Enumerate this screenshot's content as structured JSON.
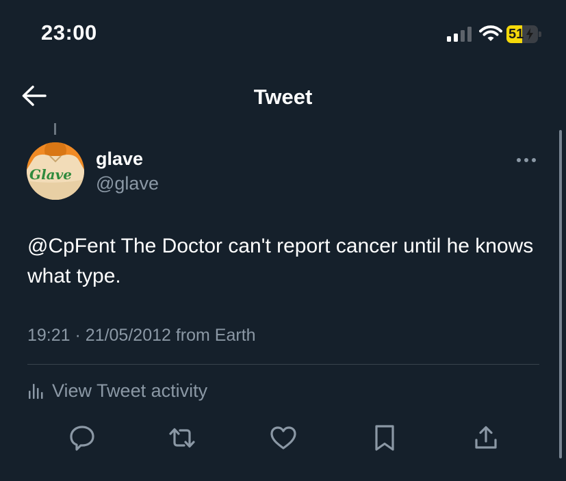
{
  "status_bar": {
    "time": "23:00",
    "battery_level": "51",
    "battery_color": "#f5d90a",
    "signal_bars_active": 2,
    "signal_bars_total": 4,
    "icons": [
      "signal-icon",
      "wifi-icon",
      "battery-icon",
      "charging-bolt-icon"
    ]
  },
  "nav": {
    "title": "Tweet",
    "back_icon": "back-arrow-icon"
  },
  "tweet": {
    "avatar": {
      "text": "Glave",
      "colors": [
        "#f08a24",
        "#2f8a3d",
        "#f2dcb8"
      ]
    },
    "display_name": "glave",
    "handle": "@glave",
    "more_icon": "more-dots-icon",
    "text": "@CpFent The Doctor can't report cancer until he knows what type.",
    "meta": "19:21 · 21/05/2012 from Earth",
    "activity_label": "View Tweet activity",
    "activity_icon": "analytics-icon"
  },
  "actions": [
    {
      "name": "reply-button",
      "icon": "reply-icon"
    },
    {
      "name": "retweet-button",
      "icon": "retweet-icon"
    },
    {
      "name": "like-button",
      "icon": "heart-icon"
    },
    {
      "name": "bookmark-button",
      "icon": "bookmark-icon"
    },
    {
      "name": "share-button",
      "icon": "share-icon"
    }
  ],
  "colors": {
    "background": "#15202b",
    "text_primary": "#ffffff",
    "text_secondary": "#8b98a5",
    "divider": "#38444d"
  }
}
